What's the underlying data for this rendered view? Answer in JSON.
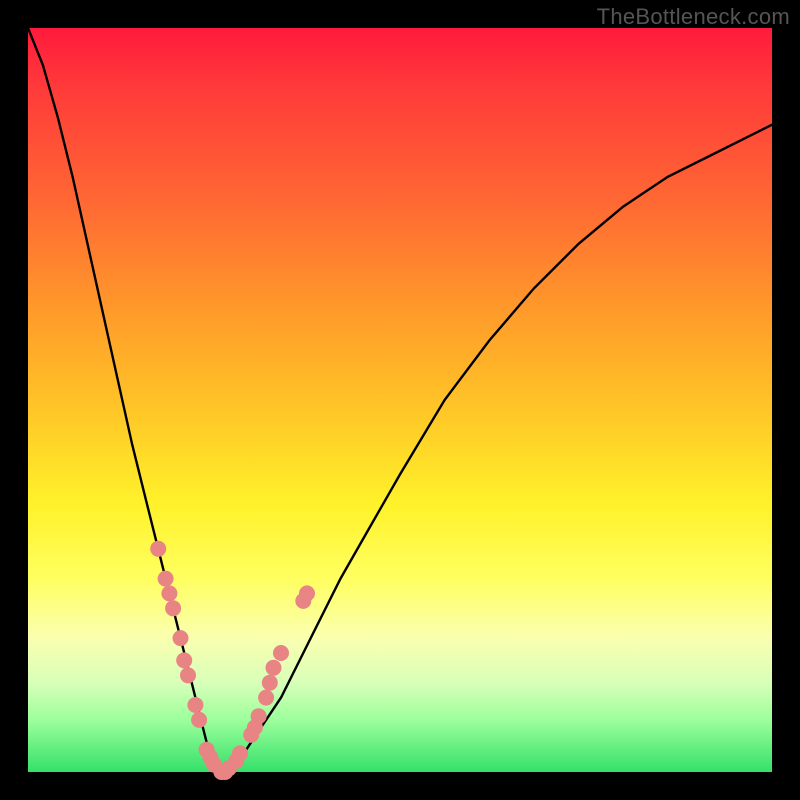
{
  "watermark": "TheBottleneck.com",
  "colors": {
    "frame": "#000000",
    "curve_stroke": "#000000",
    "dot_fill": "#e98484",
    "gradient_stops": [
      "#ff1a3c",
      "#ff6a33",
      "#ffc827",
      "#fff22a",
      "#faffb0",
      "#9cff9c",
      "#34e06a"
    ]
  },
  "chart_data": {
    "type": "line",
    "title": "",
    "xlabel": "",
    "ylabel": "",
    "xlim": [
      0,
      100
    ],
    "ylim": [
      0,
      100
    ],
    "grid": false,
    "legend": false,
    "annotations": [
      "TheBottleneck.com"
    ],
    "series": [
      {
        "name": "bottleneck-curve",
        "x": [
          0,
          2,
          4,
          6,
          8,
          10,
          12,
          14,
          16,
          18,
          20,
          22,
          23,
          24,
          25,
          26,
          27,
          28,
          30,
          34,
          38,
          42,
          46,
          50,
          56,
          62,
          68,
          74,
          80,
          86,
          92,
          98,
          100
        ],
        "y": [
          100,
          95,
          88,
          80,
          71,
          62,
          53,
          44,
          36,
          28,
          20,
          12,
          8,
          4,
          1,
          0,
          0,
          1,
          4,
          10,
          18,
          26,
          33,
          40,
          50,
          58,
          65,
          71,
          76,
          80,
          83,
          86,
          87
        ]
      }
    ],
    "markers": [
      {
        "name": "cluster-points",
        "comment": "approximate positions of salmon dots along curve (x,y in 0-100 space)",
        "points": [
          [
            17.5,
            30
          ],
          [
            18.5,
            26
          ],
          [
            19,
            24
          ],
          [
            19.5,
            22
          ],
          [
            20.5,
            18
          ],
          [
            21,
            15
          ],
          [
            21.5,
            13
          ],
          [
            22.5,
            9
          ],
          [
            23,
            7
          ],
          [
            24,
            3
          ],
          [
            24.5,
            2
          ],
          [
            25,
            1
          ],
          [
            26,
            0
          ],
          [
            26.5,
            0
          ],
          [
            27,
            0.5
          ],
          [
            28,
            1.5
          ],
          [
            28.5,
            2.5
          ],
          [
            30,
            5
          ],
          [
            30.5,
            6
          ],
          [
            31,
            7.5
          ],
          [
            32,
            10
          ],
          [
            32.5,
            12
          ],
          [
            33,
            14
          ],
          [
            34,
            16
          ],
          [
            37,
            23
          ],
          [
            37.5,
            24
          ]
        ]
      }
    ]
  }
}
